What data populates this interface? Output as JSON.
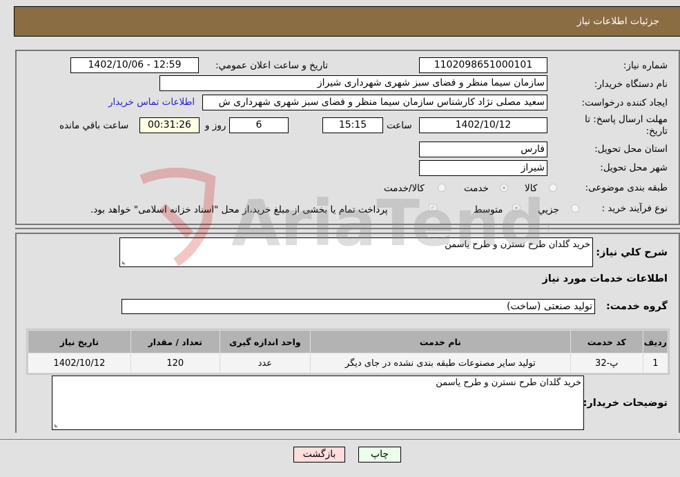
{
  "header": {
    "title": "جزئیات اطلاعات نیاز"
  },
  "form": {
    "need_number": {
      "label": "شماره نیاز:",
      "value": "1102098651000101"
    },
    "announce_datetime": {
      "label": "تاریخ و ساعت اعلان عمومي:",
      "value": "1402/10/06 - 12:59"
    },
    "buyer_org": {
      "label": "نام دستگاه خریدار:",
      "value": "سازمان سیما منظر و فضای سبز شهری شهرداری شیراز"
    },
    "requester": {
      "label": "ایجاد کننده درخواست:",
      "value": "سعید مصلی نژاد کارشناس سازمان سیما منظر و فضای سبز شهری شهرداری ش"
    },
    "buyer_contact_link": "اطلاعات تماس خریدار",
    "deadline": {
      "label_line1": "مهلت ارسال پاسخ: تا",
      "label_line2": "تاریخ:",
      "date": "1402/10/12",
      "time_label": "ساعت",
      "time": "15:15",
      "days": "6",
      "days_label": "روز و",
      "remaining": "00:31:26",
      "remaining_label": "ساعت باقي مانده"
    },
    "province": {
      "label": "استان محل تحویل:",
      "value": "فارس"
    },
    "city": {
      "label": "شهر محل تحویل:",
      "value": "شیراز"
    },
    "category": {
      "label": "طبقه بندی موضوعی:",
      "options": [
        "کالا",
        "خدمت",
        "کالا/خدمت"
      ],
      "selected": "خدمت"
    },
    "purchase_type": {
      "label": "نوع فرآیند خرید :",
      "options": [
        "جزيي",
        "متوسط"
      ],
      "selected": "متوسط",
      "treasury_note": "پرداخت تمام یا بخشی از مبلغ خرید،از محل \"اسناد خزانه اسلامی\" خواهد بود.",
      "treasury_checked": true
    }
  },
  "details": {
    "general_desc": {
      "label": "شرح کلي نیاز:",
      "value": "خرید گلدان طرح نسترن و طرح یاسمن"
    },
    "services_heading": "اطلاعات خدمات مورد نیاز",
    "service_group": {
      "label": "گروه خدمت:",
      "value": "تولید صنعتی (ساخت)"
    },
    "table": {
      "headers": [
        "ردیف",
        "کد خدمت",
        "نام خدمت",
        "واحد اندازه گیری",
        "تعداد / مقدار",
        "تاریخ نیاز"
      ],
      "rows": [
        [
          "1",
          "پ-32",
          "تولید سایر مصنوعات طبقه بندی نشده در جای دیگر",
          "عدد",
          "120",
          "1402/10/12"
        ]
      ]
    },
    "buyer_notes": {
      "label": "توضیحات خریدار:",
      "value": "خرید گلدان طرح نسترن و طرح یاسمن"
    }
  },
  "buttons": {
    "print": "چاپ",
    "back": "بازگشت"
  },
  "watermark": {
    "text": "AriaTender.neT"
  },
  "colors": {
    "header_bg": "#8b6d43",
    "link": "#2222cc",
    "print_bg": "#eaffea",
    "back_bg": "#ffdddd"
  }
}
